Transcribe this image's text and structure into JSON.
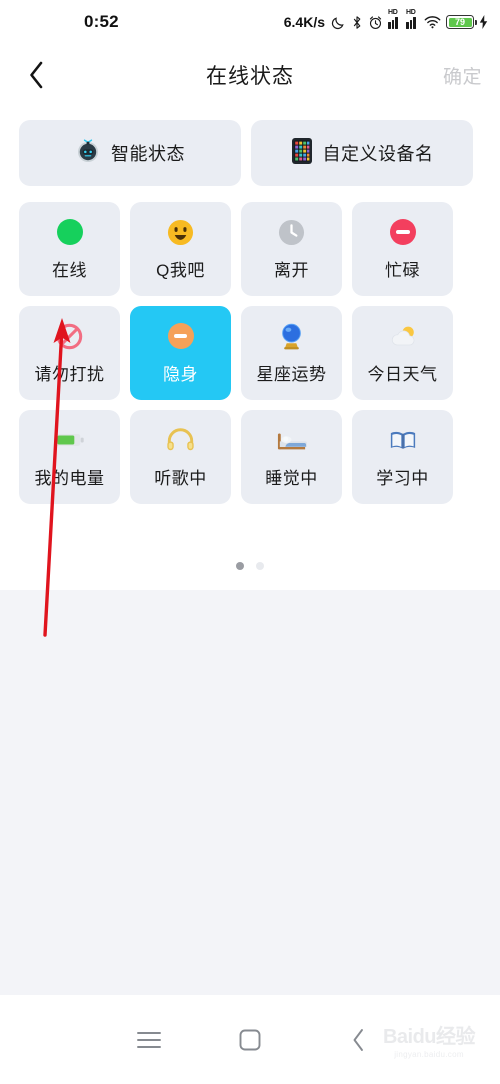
{
  "statusbar": {
    "time": "0:52",
    "network_speed": "6.4K/s",
    "battery_percent": "79",
    "icons": [
      "moon-icon",
      "bluetooth-icon",
      "alarm-icon",
      "hd-signal-icon",
      "hd-signal-icon",
      "wifi-icon",
      "battery-icon",
      "charging-bolt-icon"
    ]
  },
  "header": {
    "back_label": "‹",
    "title": "在线状态",
    "confirm_label": "确定"
  },
  "top_buttons": [
    {
      "label": "智能状态",
      "icon": "robot-icon"
    },
    {
      "label": "自定义设备名",
      "icon": "device-grid-icon"
    }
  ],
  "status_grid": [
    {
      "label": "在线",
      "icon": "green-dot-icon",
      "selected": false
    },
    {
      "label": "Q我吧",
      "icon": "smiley-icon",
      "selected": false
    },
    {
      "label": "离开",
      "icon": "clock-icon",
      "selected": false
    },
    {
      "label": "忙碌",
      "icon": "busy-minus-icon",
      "selected": false
    },
    {
      "label": "请勿打扰",
      "icon": "no-entry-icon",
      "selected": false
    },
    {
      "label": "隐身",
      "icon": "invisible-icon",
      "selected": true
    },
    {
      "label": "星座运势",
      "icon": "crystal-ball-icon",
      "selected": false
    },
    {
      "label": "今日天气",
      "icon": "sun-cloud-icon",
      "selected": false
    },
    {
      "label": "我的电量",
      "icon": "battery-icon",
      "selected": false
    },
    {
      "label": "听歌中",
      "icon": "headphones-icon",
      "selected": false
    },
    {
      "label": "睡觉中",
      "icon": "bed-icon",
      "selected": false
    },
    {
      "label": "学习中",
      "icon": "open-book-icon",
      "selected": false
    }
  ],
  "pagination": {
    "total": 2,
    "active_index": 0
  },
  "navbar": {
    "menu_label": "menu-icon",
    "home_label": "home-icon",
    "back_label": "back-icon"
  },
  "watermark": {
    "main": "Baidu经验",
    "sub": "jingyan.baidu.com"
  },
  "colors": {
    "selected_tile": "#24C8F4",
    "tile_background": "#EAEDF3",
    "page_background": "#F3F4F8",
    "annotation_arrow": "#E0141E",
    "online_green": "#16D05C",
    "busy_red": "#F33F5E"
  }
}
